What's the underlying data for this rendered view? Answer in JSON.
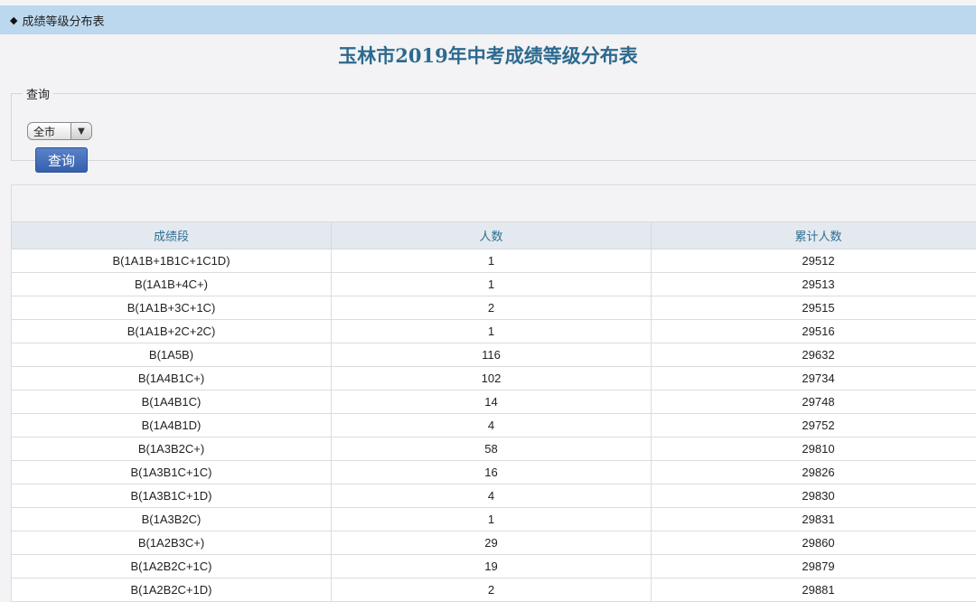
{
  "nav": {
    "diamond": "◆",
    "title": "成绩等级分布表"
  },
  "page_title": "玉林市2019年中考成绩等级分布表",
  "query": {
    "legend": "查询",
    "select_value": "全市",
    "button_label": "查询"
  },
  "table": {
    "headers": [
      "成绩段",
      "人数",
      "累计人数"
    ],
    "rows": [
      [
        "B(1A1B+1B1C+1C1D)",
        "1",
        "29512"
      ],
      [
        "B(1A1B+4C+)",
        "1",
        "29513"
      ],
      [
        "B(1A1B+3C+1C)",
        "2",
        "29515"
      ],
      [
        "B(1A1B+2C+2C)",
        "1",
        "29516"
      ],
      [
        "B(1A5B)",
        "116",
        "29632"
      ],
      [
        "B(1A4B1C+)",
        "102",
        "29734"
      ],
      [
        "B(1A4B1C)",
        "14",
        "29748"
      ],
      [
        "B(1A4B1D)",
        "4",
        "29752"
      ],
      [
        "B(1A3B2C+)",
        "58",
        "29810"
      ],
      [
        "B(1A3B1C+1C)",
        "16",
        "29826"
      ],
      [
        "B(1A3B1C+1D)",
        "4",
        "29830"
      ],
      [
        "B(1A3B2C)",
        "1",
        "29831"
      ],
      [
        "B(1A2B3C+)",
        "29",
        "29860"
      ],
      [
        "B(1A2B2C+1C)",
        "19",
        "29879"
      ],
      [
        "B(1A2B2C+1D)",
        "2",
        "29881"
      ]
    ]
  }
}
